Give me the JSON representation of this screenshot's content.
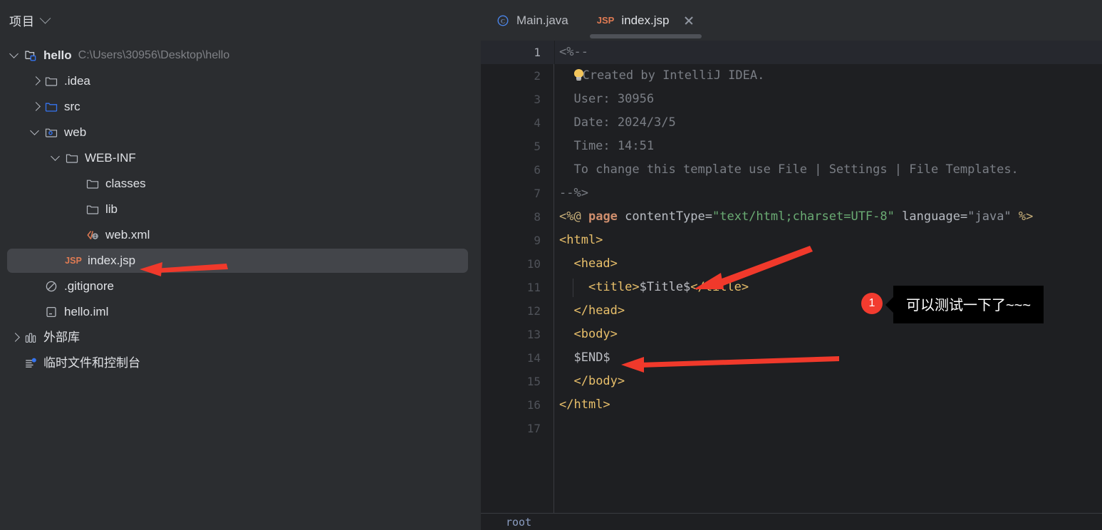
{
  "sidebar": {
    "header": {
      "title": "项目",
      "chevron_icon": "chevron-down-icon"
    },
    "tree": [
      {
        "id": "hello",
        "label": "hello",
        "path": "C:\\Users\\30956\\Desktop\\hello",
        "icon": "module-folder-icon",
        "arrow": "down",
        "indent": 0,
        "bold": true,
        "selected": false
      },
      {
        "id": "idea",
        "label": ".idea",
        "path": "",
        "icon": "folder-icon",
        "arrow": "right",
        "indent": 1,
        "bold": false,
        "selected": false
      },
      {
        "id": "src",
        "label": "src",
        "path": "",
        "icon": "source-folder-icon",
        "arrow": "right",
        "indent": 1,
        "bold": false,
        "selected": false
      },
      {
        "id": "web",
        "label": "web",
        "path": "",
        "icon": "web-folder-icon",
        "arrow": "down",
        "indent": 1,
        "bold": false,
        "selected": false
      },
      {
        "id": "webinf",
        "label": "WEB-INF",
        "path": "",
        "icon": "folder-icon",
        "arrow": "down",
        "indent": 2,
        "bold": false,
        "selected": false
      },
      {
        "id": "classes",
        "label": "classes",
        "path": "",
        "icon": "folder-icon",
        "arrow": "none",
        "indent": 3,
        "bold": false,
        "selected": false
      },
      {
        "id": "lib",
        "label": "lib",
        "path": "",
        "icon": "folder-icon",
        "arrow": "none",
        "indent": 3,
        "bold": false,
        "selected": false
      },
      {
        "id": "webxml",
        "label": "web.xml",
        "path": "",
        "icon": "xml-file-icon",
        "arrow": "none",
        "indent": 3,
        "bold": false,
        "selected": false
      },
      {
        "id": "indexjsp",
        "label": "index.jsp",
        "path": "",
        "icon": "jsp-file-icon",
        "arrow": "none",
        "indent": 2,
        "bold": false,
        "selected": true
      },
      {
        "id": "gitignore",
        "label": ".gitignore",
        "path": "",
        "icon": "gitignore-file-icon",
        "arrow": "none",
        "indent": 1,
        "bold": false,
        "selected": false
      },
      {
        "id": "helloiml",
        "label": "hello.iml",
        "path": "",
        "icon": "iml-file-icon",
        "arrow": "none",
        "indent": 1,
        "bold": false,
        "selected": false
      },
      {
        "id": "extlibs",
        "label": "外部库",
        "path": "",
        "icon": "library-icon",
        "arrow": "right",
        "indent": 0,
        "bold": false,
        "selected": false
      },
      {
        "id": "scratches",
        "label": "临时文件和控制台",
        "path": "",
        "icon": "scratches-icon",
        "arrow": "none",
        "indent": 0,
        "bold": false,
        "selected": false
      }
    ]
  },
  "editor": {
    "tabs": [
      {
        "label": "Main.java",
        "icon": "java-class-icon",
        "active": false,
        "closable": false
      },
      {
        "label": "index.jsp",
        "icon": "jsp-file-icon",
        "active": true,
        "closable": true
      }
    ],
    "close_icon": "close-icon",
    "line_numbers": [
      "1",
      "2",
      "3",
      "4",
      "5",
      "6",
      "7",
      "8",
      "9",
      "10",
      "11",
      "12",
      "13",
      "14",
      "15",
      "16",
      "17"
    ],
    "current_line": 1,
    "breadcrumb": "root",
    "code_lines": [
      {
        "n": 1,
        "text": "<%--"
      },
      {
        "n": 2,
        "text": "  Created by IntelliJ IDEA."
      },
      {
        "n": 3,
        "text": "  User: 30956"
      },
      {
        "n": 4,
        "text": "  Date: 2024/3/5"
      },
      {
        "n": 5,
        "text": "  Time: 14:51"
      },
      {
        "n": 6,
        "text": "  To change this template use File | Settings | File Templates."
      },
      {
        "n": 7,
        "text": "--%>"
      },
      {
        "n": 8,
        "text": "<%@ page contentType=\"text/html;charset=UTF-8\" language=\"java\" %>"
      },
      {
        "n": 9,
        "text": "<html>"
      },
      {
        "n": 10,
        "text": "  <head>"
      },
      {
        "n": 11,
        "text": "    <title>$Title$</title>"
      },
      {
        "n": 12,
        "text": "  </head>"
      },
      {
        "n": 13,
        "text": "  <body>"
      },
      {
        "n": 14,
        "text": "  $END$"
      },
      {
        "n": 15,
        "text": "  </body>"
      },
      {
        "n": 16,
        "text": "</html>"
      },
      {
        "n": 17,
        "text": ""
      }
    ]
  },
  "annotations": {
    "badge_label": "1",
    "callout_text": "可以测试一下了~~~",
    "arrow_color": "#f0392b",
    "badge_color": "#f23b2f",
    "callout_bg": "#000000"
  },
  "colors": {
    "sidebar_bg": "#2b2d30",
    "editor_bg": "#1e1f22",
    "selection_bg": "#43454a",
    "tab_underline": "#4e5157",
    "tag_color": "#e8bf6a",
    "string_color": "#6aab73",
    "comment_color": "#7a7e85",
    "keyword_color": "#cf8e6d",
    "jsp_icon_color": "#e07b53"
  }
}
